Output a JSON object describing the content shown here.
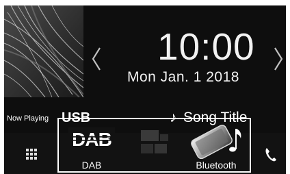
{
  "clock": {
    "time": "10:00",
    "date": "Mon Jan.  1  2018"
  },
  "now_playing": {
    "label": "Now Playing",
    "source": "USB",
    "note_glyph": "♪",
    "song_title": "Song Title"
  },
  "shortcuts": [
    {
      "label": "DAB",
      "icon": "dab-logo-icon"
    },
    {
      "label": "",
      "icon": "grid-placeholder-icon"
    },
    {
      "label": "Bluetooth",
      "icon": "bluetooth-phone-music-icon"
    }
  ],
  "icons": {
    "menu": "grid-menu-icon",
    "phone": "phone-icon",
    "prev": "chevron-left-icon",
    "next": "chevron-right-icon"
  },
  "dab_logo_text": "DAB",
  "colors": {
    "background": "#0e0e0e",
    "text": "#f2f2f2",
    "frame": "#ffffff"
  }
}
